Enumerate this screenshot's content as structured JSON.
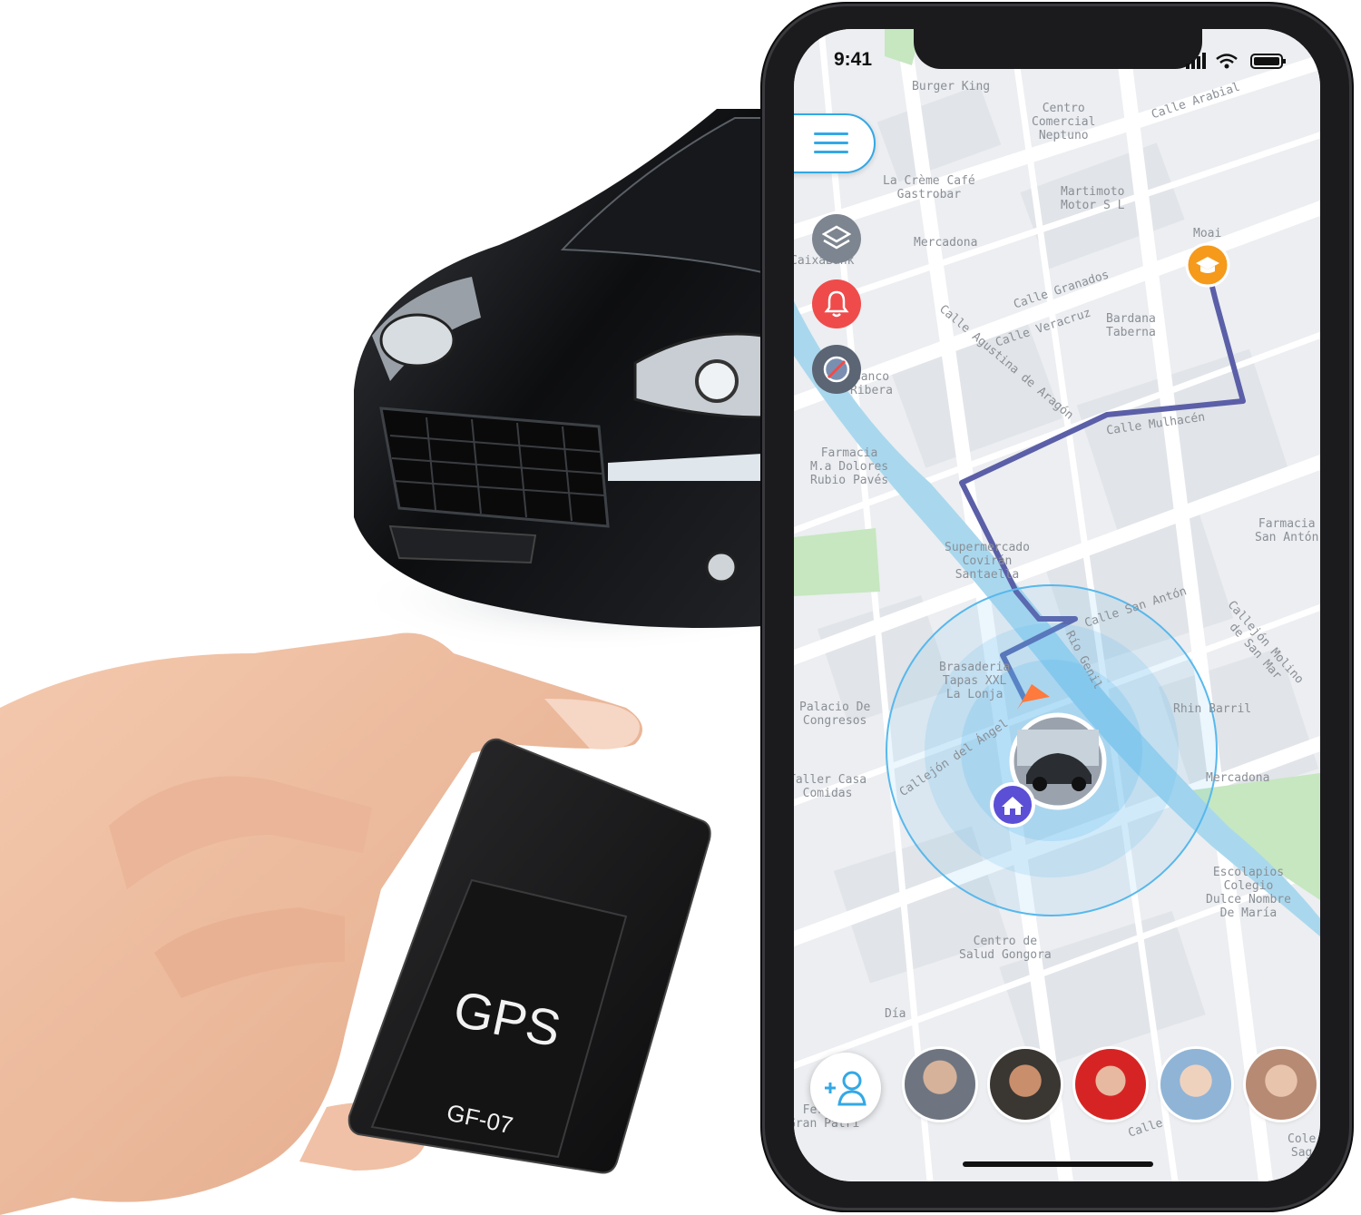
{
  "status_bar": {
    "time": "9:41"
  },
  "map": {
    "labels": [
      {
        "text": "Burger King",
        "id": "burger-king"
      },
      {
        "text": "Centro\nComercial\nNeptuno",
        "id": "centro-comercial"
      },
      {
        "text": "Calle Arabial",
        "id": "calle-arabial"
      },
      {
        "text": "La Crème Café\nGastrobar",
        "id": "la-creme"
      },
      {
        "text": "Martimoto\nMotor S L",
        "id": "martimoto"
      },
      {
        "text": "Mercadona",
        "id": "mercadona-top"
      },
      {
        "text": "Moai",
        "id": "moai"
      },
      {
        "text": "CaixaBank",
        "id": "caixabank"
      },
      {
        "text": "Calle Granados",
        "id": "calle-granados"
      },
      {
        "text": "Calle Veracruz",
        "id": "calle-veracruz"
      },
      {
        "text": "Bardana\nTaberna",
        "id": "bardana"
      },
      {
        "text": "Calle Agustina de Aragón",
        "id": "calle-agustina"
      },
      {
        "text": "Banco\nRibera",
        "id": "banco-ribera"
      },
      {
        "text": "Calle Mulhacén",
        "id": "calle-mulhacen"
      },
      {
        "text": "Farmacia\nM.a Dolores\nRubio Pavés",
        "id": "farmacia-dolores"
      },
      {
        "text": "Farmacia\nSan Antón",
        "id": "farmacia-anton"
      },
      {
        "text": "Supermercado\nCovirán\nSantaella",
        "id": "supermercado"
      },
      {
        "text": "Calle San Antón",
        "id": "calle-san-anton"
      },
      {
        "text": "Callejón Molino de San Mar",
        "id": "callejon-molino"
      },
      {
        "text": "Brasaderia\nTapas XXL\nLa Lonja",
        "id": "brasaderia"
      },
      {
        "text": "Río Genil",
        "id": "rio-genil"
      },
      {
        "text": "Palacio De\nCongresos",
        "id": "palacio"
      },
      {
        "text": "Rhin Barril",
        "id": "rhin-barril"
      },
      {
        "text": "Callejón del Ángel",
        "id": "callejon-angel"
      },
      {
        "text": "Taller Casa\nComidas",
        "id": "taller-casa"
      },
      {
        "text": "Mercadona",
        "id": "mercadona-bottom"
      },
      {
        "text": "Escolapios\nColegio\nDulce Nombre\nDe María",
        "id": "escolapios"
      },
      {
        "text": "Centro de\nSalud Gongora",
        "id": "centro-salud"
      },
      {
        "text": "Día",
        "id": "dia"
      },
      {
        "text": "Fermín\nGran Patri",
        "id": "fermin"
      },
      {
        "text": "Calle",
        "id": "calle-bottom"
      },
      {
        "text": "Cole\nSag",
        "id": "cole-sag"
      }
    ]
  },
  "device": {
    "label": "GPS",
    "model": "GF-07"
  },
  "colors": {
    "accent": "#33a8e6",
    "route": "#5b5fa8",
    "alert": "#ef4b4b",
    "layers": "#7d8590",
    "poi_orange": "#f59a1b",
    "home_pin": "#5b4fd6",
    "geofence": "#57b8ec"
  },
  "icons": {
    "menu": "hamburger-icon",
    "layers": "layers-icon",
    "alert": "bell-icon",
    "no_parking": "no-entry-icon",
    "home": "home-icon",
    "add_friend": "add-person-icon",
    "poi": "school-cap-icon"
  }
}
